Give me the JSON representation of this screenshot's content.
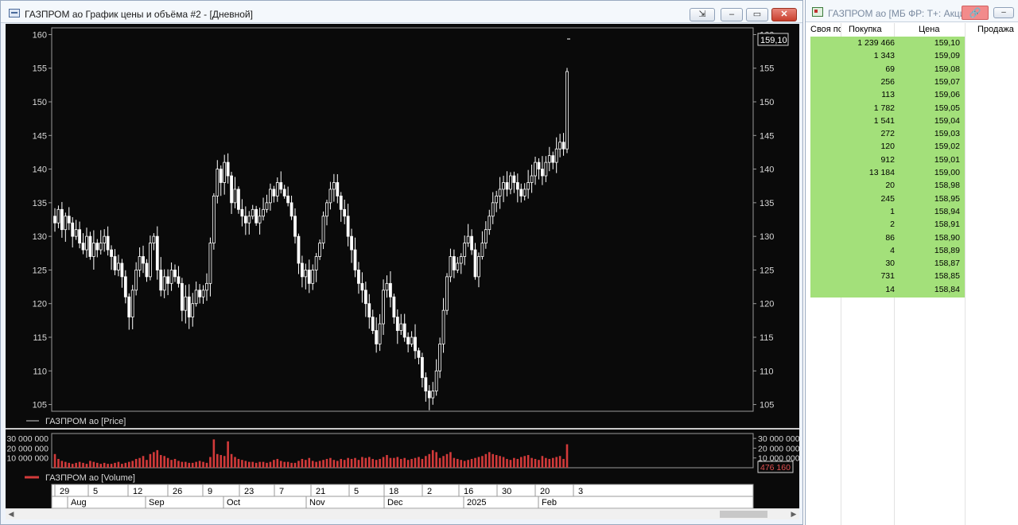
{
  "chart_window": {
    "title": "ГАЗПРОМ ао График цены и объёма #2 - [Дневной]",
    "buttons": {
      "pin": "⇲",
      "minimize": "–",
      "maximize": "▭",
      "close": "✕"
    },
    "price_legend": "ГАЗПРОМ ао [Price]",
    "volume_legend": "ГАЗПРОМ ао [Volume]",
    "last_price_label": "159,10",
    "last_volume_label": "476 160",
    "colors": {
      "candle": "#ffffff",
      "volume": "#d23a3a",
      "background": "#0a0a0a",
      "last_volume_text": "#e05050"
    }
  },
  "order_book": {
    "title": "ГАЗПРОМ ао [МБ ФР: Т+: Акции",
    "link_icon": "link-icon",
    "columns": {
      "own": "Своя по",
      "buy": "Покупка",
      "price": "Цена",
      "sell": "Продажа"
    },
    "rows": [
      {
        "vol": "1 239 466",
        "price": "159,10"
      },
      {
        "vol": "1 343",
        "price": "159,09"
      },
      {
        "vol": "69",
        "price": "159,08"
      },
      {
        "vol": "256",
        "price": "159,07"
      },
      {
        "vol": "113",
        "price": "159,06"
      },
      {
        "vol": "1 782",
        "price": "159,05"
      },
      {
        "vol": "1 541",
        "price": "159,04"
      },
      {
        "vol": "272",
        "price": "159,03"
      },
      {
        "vol": "120",
        "price": "159,02"
      },
      {
        "vol": "912",
        "price": "159,01"
      },
      {
        "vol": "13 184",
        "price": "159,00"
      },
      {
        "vol": "20",
        "price": "158,98"
      },
      {
        "vol": "245",
        "price": "158,95"
      },
      {
        "vol": "1",
        "price": "158,94"
      },
      {
        "vol": "2",
        "price": "158,91"
      },
      {
        "vol": "86",
        "price": "158,90"
      },
      {
        "vol": "4",
        "price": "158,89"
      },
      {
        "vol": "30",
        "price": "158,87"
      },
      {
        "vol": "731",
        "price": "158,85"
      },
      {
        "vol": "14",
        "price": "158,84"
      }
    ],
    "bid_color": "#a3e07a"
  },
  "chart_data": [
    {
      "type": "candlestick",
      "title": "ГАЗПРОМ ао [Price]",
      "ylim": [
        104,
        161
      ],
      "yticks": [
        105,
        110,
        115,
        120,
        125,
        130,
        135,
        140,
        145,
        150,
        155,
        160
      ],
      "ytick_labels": [
        "105",
        "110",
        "115",
        "120",
        "125",
        "130",
        "135",
        "140",
        "145",
        "150",
        "155",
        "160"
      ],
      "last_value": 159.1,
      "closes": [
        132,
        134,
        131,
        133,
        132,
        130,
        131,
        129,
        128,
        130,
        127,
        129,
        128,
        129,
        130,
        128,
        127,
        125,
        126,
        124,
        121,
        118,
        122,
        125,
        127,
        126,
        124,
        129,
        130,
        125,
        122,
        124,
        123,
        125,
        124,
        123,
        119,
        121,
        118,
        120,
        122,
        121,
        122,
        123,
        129,
        136,
        140,
        138,
        141,
        139,
        135,
        137,
        134,
        133,
        132,
        133,
        134,
        132,
        133,
        134,
        135,
        137,
        136,
        138,
        137,
        136,
        135,
        133,
        130,
        126,
        124,
        125,
        123,
        125,
        127,
        129,
        133,
        135,
        137,
        138,
        136,
        134,
        133,
        130,
        128,
        125,
        123,
        122,
        120,
        118,
        116,
        114,
        117,
        122,
        123,
        121,
        118,
        116,
        117,
        115,
        114,
        115,
        113,
        112,
        109,
        107,
        106,
        107,
        110,
        114,
        119,
        124,
        127,
        125,
        126,
        127,
        129,
        130,
        128,
        124,
        127,
        129,
        131,
        133,
        135,
        136,
        137,
        138,
        137,
        139,
        138,
        137,
        136,
        137,
        138,
        139,
        141,
        140,
        139,
        141,
        142,
        141,
        143,
        144,
        143,
        154.5
      ]
    },
    {
      "type": "bar",
      "title": "ГАЗПРОМ ао [Volume]",
      "ylim": [
        0,
        35000000
      ],
      "yticks": [
        10000000,
        20000000,
        30000000
      ],
      "ytick_labels": [
        "10 000 000",
        "20 000 000",
        "30 000 000"
      ],
      "last_value": 476160,
      "values_million": [
        14,
        9,
        7,
        6,
        5,
        4,
        5,
        6,
        5,
        4,
        7,
        6,
        5,
        4,
        5,
        4,
        4,
        5,
        6,
        4,
        5,
        6,
        7,
        9,
        10,
        12,
        8,
        14,
        16,
        18,
        13,
        12,
        10,
        8,
        9,
        7,
        6,
        6,
        5,
        5,
        6,
        7,
        6,
        5,
        11,
        29,
        14,
        13,
        12,
        27,
        14,
        11,
        9,
        8,
        7,
        6,
        6,
        5,
        6,
        6,
        5,
        6,
        8,
        9,
        7,
        6,
        6,
        5,
        5,
        7,
        9,
        8,
        10,
        7,
        6,
        7,
        8,
        9,
        10,
        8,
        7,
        9,
        8,
        10,
        9,
        10,
        8,
        11,
        10,
        11,
        9,
        8,
        9,
        11,
        13,
        10,
        10,
        11,
        9,
        10,
        8,
        9,
        10,
        11,
        9,
        12,
        14,
        18,
        16,
        10,
        12,
        14,
        16,
        10,
        9,
        8,
        7,
        8,
        9,
        10,
        11,
        12,
        14,
        16,
        14,
        13,
        12,
        11,
        9,
        8,
        10,
        9,
        11,
        12,
        13,
        10,
        9,
        8,
        12,
        10,
        9,
        10,
        11,
        12,
        9,
        24
      ]
    }
  ],
  "time_axis": {
    "days": [
      "29",
      "5",
      "12",
      "26",
      "9",
      "23",
      "7",
      "21",
      "5",
      "18",
      "2",
      "16",
      "30",
      "20",
      "3"
    ],
    "months": [
      "Aug",
      "Sep",
      "Oct",
      "Nov",
      "Dec",
      "2025",
      "Feb"
    ]
  }
}
